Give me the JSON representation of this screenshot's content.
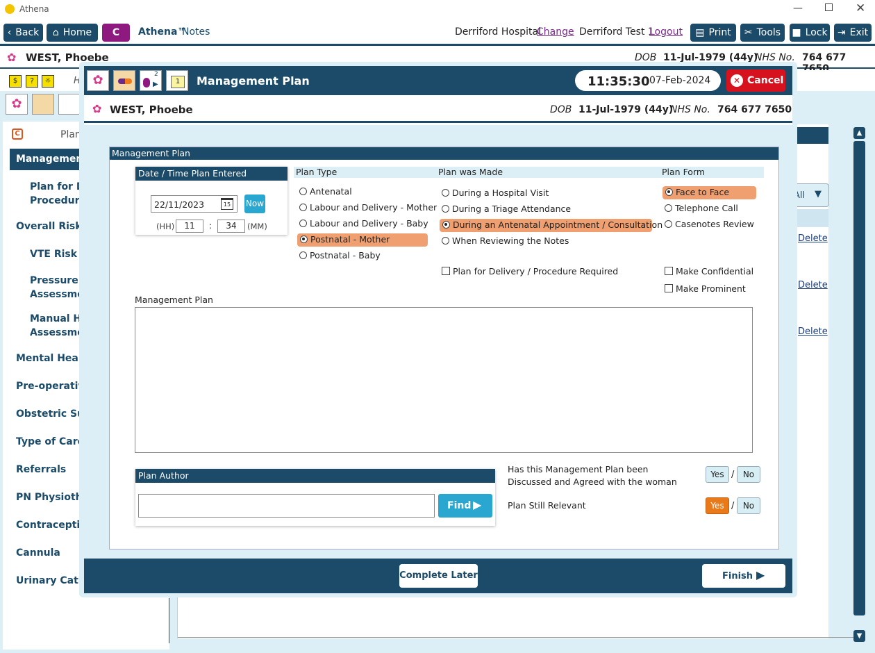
{
  "titlebar": {
    "app_title": "Athena"
  },
  "toolbar": {
    "back": "Back",
    "home": "Home",
    "c_button": "C",
    "brand": "Athena™",
    "brand_suffix": "Notes",
    "hospital": "Derriford Hospital",
    "change": "Change",
    "user": "Derriford Test 1",
    "logout": "Logout",
    "print": "Print",
    "tools": "Tools",
    "lock": "Lock",
    "exit": "Exit"
  },
  "patient": {
    "name": "WEST, Phoebe",
    "dob_label": "DOB",
    "dob": "11-Jul-1979 (44y)",
    "nhs_label": "NHS No.",
    "nhs": "764 677 7650"
  },
  "background": {
    "h_text": "H",
    "plan_label": "Plan",
    "sidebar": {
      "management": "Management",
      "plan_for_delivery": [
        "Plan for De",
        "Procedure"
      ],
      "overall_risk": "Overall Risk A",
      "vte": "VTE Risk As",
      "pressure": [
        "Pressure Ul",
        "Assessment"
      ],
      "manual": [
        "Manual Ha",
        "Assessmen"
      ],
      "mental": "Mental Health",
      "preop": "Pre-operative",
      "obstetric": "Obstetric Surg",
      "type_of_care": "Type of Care",
      "referrals": "Referrals",
      "pn_physio": "PN Physiother",
      "contraceptive": "Contraceptive",
      "cannula": "Cannula",
      "urinary": "Urinary Cathe"
    },
    "filter_all": "All",
    "delete": "Delete"
  },
  "modal": {
    "title": "Management Plan",
    "time": "11:35:30",
    "date": "07-Feb-2024",
    "cancel": "Cancel",
    "badge_count": "2",
    "calendar_day": "1",
    "section_title": "Management Plan",
    "date_time": {
      "title": "Date / Time Plan Entered",
      "date_value": "22/11/2023",
      "calendar_icon_day": "15",
      "now": "Now",
      "hh_label": "(HH)",
      "hh": "11",
      "sep": ":",
      "mm": "34",
      "mm_label": "(MM)"
    },
    "plan_type": {
      "label": "Plan Type",
      "options": [
        "Antenatal",
        "Labour and Delivery - Mother",
        "Labour and Delivery - Baby",
        "Postnatal - Mother",
        "Postnatal - Baby"
      ],
      "selected": "Postnatal - Mother"
    },
    "plan_made": {
      "label": "Plan was Made",
      "options": [
        "During a Hospital Visit",
        "During a Triage Attendance",
        "During an Antenatal Appointment / Consultation",
        "When Reviewing the Notes"
      ],
      "selected": "During an Antenatal Appointment / Consultation"
    },
    "plan_form": {
      "label": "Plan Form",
      "options": [
        "Face to Face",
        "Telephone Call",
        "Casenotes Review"
      ],
      "selected": "Face to Face"
    },
    "plan_for_delivery": "Plan for Delivery / Procedure Required",
    "make_confidential": "Make Confidential",
    "make_prominent": "Make Prominent",
    "management_plan_label": "Management Plan",
    "management_plan_text": "",
    "author": {
      "title": "Plan Author",
      "value": "",
      "find": "Find"
    },
    "discussed": {
      "label": "Has this Management Plan been Discussed and Agreed with the woman",
      "yes": "Yes",
      "no": "No",
      "selected": "none"
    },
    "relevant": {
      "label": "Plan Still Relevant",
      "yes": "Yes",
      "no": "No",
      "selected": "Yes"
    },
    "slash": "/",
    "complete_later": "Complete Later",
    "finish": "Finish"
  },
  "colors": {
    "primary": "#1b4b69",
    "highlight": "#f0a070",
    "accent": "#2aa7d0",
    "cancel": "#d6121f",
    "yes_selected": "#e87a1a",
    "brand_purple": "#8e1a80"
  }
}
